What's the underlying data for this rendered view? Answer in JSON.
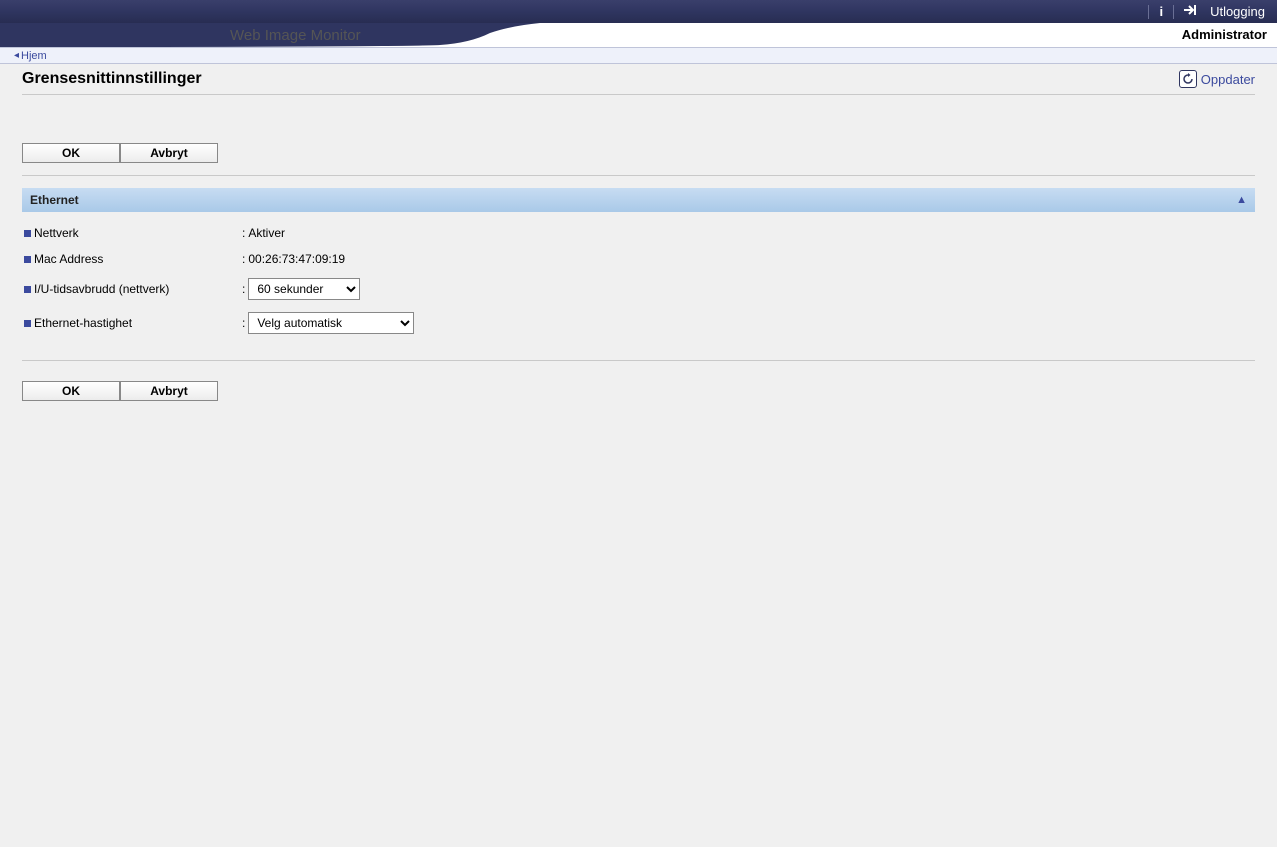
{
  "header": {
    "logout_label": "Utlogging",
    "app_title": "Web Image Monitor",
    "user_role": "Administrator"
  },
  "breadcrumb": {
    "home_label": "Hjem"
  },
  "page": {
    "title": "Grensesnittinnstillinger",
    "refresh_label": "Oppdater"
  },
  "buttons": {
    "ok": "OK",
    "cancel": "Avbryt"
  },
  "section": {
    "title": "Ethernet",
    "rows": {
      "network": {
        "label": "Nettverk",
        "value": "Aktiver"
      },
      "mac": {
        "label": "Mac Address",
        "value": "00:26:73:47:09:19"
      },
      "timeout": {
        "label": "I/U-tidsavbrudd (nettverk)",
        "selected": "60 sekunder"
      },
      "speed": {
        "label": "Ethernet-hastighet",
        "selected": "Velg automatisk"
      }
    }
  }
}
